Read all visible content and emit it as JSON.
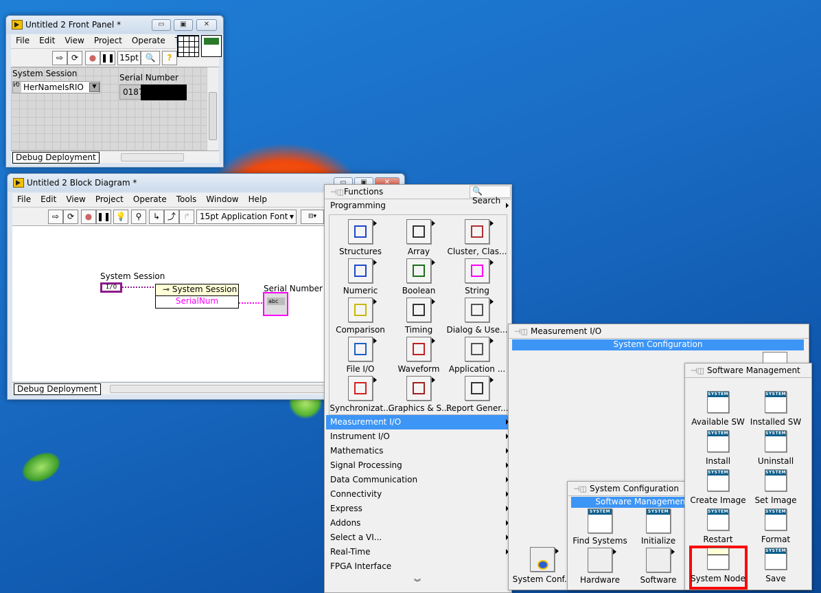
{
  "front_panel": {
    "title": "Untitled 2 Front Panel *",
    "menu": [
      "File",
      "Edit",
      "View",
      "Project",
      "Operate",
      "To"
    ],
    "font_size": "15pt",
    "system_session_label": "System Session",
    "system_session_value": "HerNameIsRIO",
    "serial_label": "Serial Number",
    "serial_value": "0187",
    "target": "Debug Deployment"
  },
  "block_diagram": {
    "title": "Untitled 2 Block Diagram *",
    "menu": [
      "File",
      "Edit",
      "View",
      "Project",
      "Operate",
      "Tools",
      "Window",
      "Help"
    ],
    "font": "15pt Application Font",
    "session_label": "System Session",
    "session_terminal": "I/O",
    "node_title": "System Session",
    "node_property": "SerialNum",
    "serial_label": "Serial Number",
    "indicator_text": "abc",
    "target": "Debug Deployment"
  },
  "functions": {
    "title": "Functions",
    "search": "Search",
    "category": "Programming",
    "tiles": [
      "Structures",
      "Array",
      "Cluster, Clas...",
      "Numeric",
      "Boolean",
      "String",
      "Comparison",
      "Timing",
      "Dialog & Use...",
      "File I/O",
      "Waveform",
      "Application ...",
      "Synchronizat...",
      "Graphics & S...",
      "Report Gener..."
    ],
    "list": [
      "Measurement I/O",
      "Instrument I/O",
      "Mathematics",
      "Signal Processing",
      "Data Communication",
      "Connectivity",
      "Express",
      "Addons",
      "Select a VI...",
      "Real-Time",
      "FPGA Interface"
    ],
    "selected": "Measurement I/O"
  },
  "measurement_io": {
    "title": "Measurement I/O",
    "bar": "System Configuration",
    "tile": "System Conf..."
  },
  "system_configuration": {
    "title": "System Configuration",
    "bar": "Software Management",
    "tiles": [
      "Find Systems",
      "Initialize",
      "Hardware",
      "Software"
    ]
  },
  "software_management": {
    "title": "Software Management",
    "tiles": [
      "Available SW",
      "Installed SW",
      "Install",
      "Uninstall",
      "Create Image",
      "Set Image",
      "Restart",
      "Format",
      "System Node",
      "Save"
    ],
    "highlighted": "System Node",
    "highlight_color": "#ff0000"
  },
  "colors": {
    "selection": "#3d95f5",
    "string_wire": "#ff00ff",
    "session_wire": "#8b1a8b"
  }
}
